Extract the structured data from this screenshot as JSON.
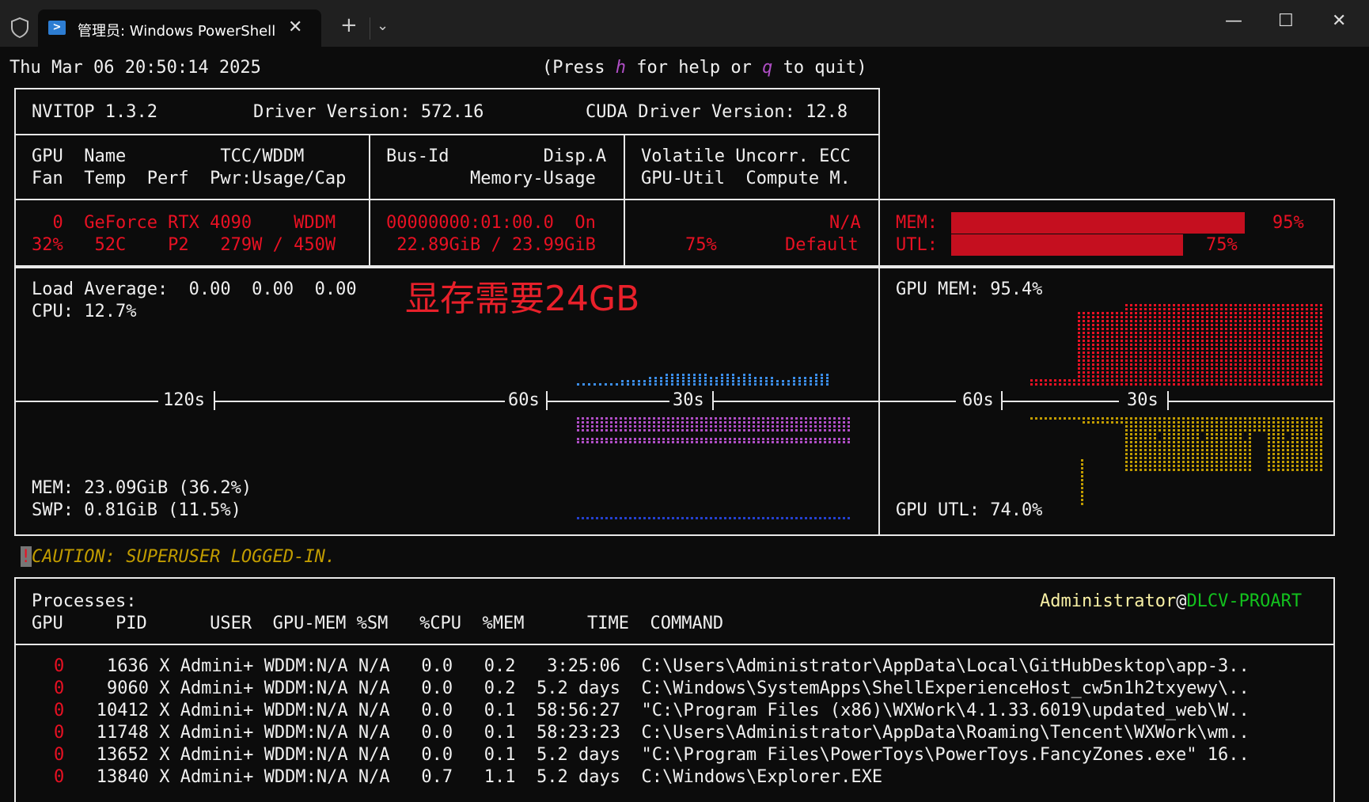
{
  "window": {
    "tab_title": "管理员: Windows PowerShell",
    "tab_close": "✕",
    "new_tab": "+",
    "dropdown": "⌄",
    "minimize": "—",
    "maximize": "☐",
    "close": "✕"
  },
  "header": {
    "datetime": "Thu Mar 06 20:50:14 2025",
    "help_pre": "(Press ",
    "help_h": "h",
    "help_mid": " for help or ",
    "help_q": "q",
    "help_post": " to quit)"
  },
  "top": {
    "version": "NVITOP 1.3.2",
    "driver": "Driver Version: 572.16",
    "cuda": "CUDA Driver Version: 12.8"
  },
  "columns": {
    "c1_l1": "GPU  Name         TCC/WDDM",
    "c1_l2": "Fan  Temp  Perf  Pwr:Usage/Cap",
    "c2_l1": "Bus-Id         Disp.A",
    "c2_l2": "        Memory-Usage",
    "c3_l1": "Volatile Uncorr. ECC",
    "c3_l2": "GPU-Util  Compute M."
  },
  "gpu": {
    "r1": "  0  GeForce RTX 4090    WDDM",
    "r2": "32%   52C    P2   279W / 450W",
    "bus": "00000000:01:00.0  On",
    "mem_usage": " 22.89GiB / 23.99GiB",
    "ecc": "N/A",
    "util": "75%",
    "compute": "Default",
    "mem_label": "MEM:",
    "mem_pct_text": "95%",
    "mem_fraction": 0.95,
    "utl_label": "UTL:",
    "utl_pct_text": "75%",
    "utl_fraction": 0.75
  },
  "host": {
    "load": "Load Average:  0.00  0.00  0.00",
    "cpu": "CPU: 12.7%",
    "mem": "MEM: 23.09GiB (36.2%)",
    "swp": "SWP: 0.81GiB (11.5%)",
    "annotation": "显存需要24GB",
    "tick_120": "120s",
    "tick_60": "60s",
    "tick_30": "30s"
  },
  "gpu_graph": {
    "mem": "GPU MEM: 95.4%",
    "utl": "GPU UTL: 74.0%",
    "tick_60": "60s",
    "tick_30": "30s"
  },
  "caution": {
    "mark": "!",
    "text": "CAUTION: SUPERUSER LOGGED-IN."
  },
  "processes": {
    "title": "Processes:",
    "user": "Administrator",
    "at": "@",
    "host": "DLCV-PROART",
    "header": "GPU     PID      USER  GPU-MEM %SM   %CPU  %MEM      TIME  COMMAND",
    "rows": [
      {
        "gpu": "0",
        "rest": "    1636 X Admini+ WDDM:N/A N/A   0.0   0.2   3:25:06  C:\\Users\\Administrator\\AppData\\Local\\GitHubDesktop\\app-3.."
      },
      {
        "gpu": "0",
        "rest": "    9060 X Admini+ WDDM:N/A N/A   0.0   0.2  5.2 days  C:\\Windows\\SystemApps\\ShellExperienceHost_cw5n1h2txyewy\\.."
      },
      {
        "gpu": "0",
        "rest": "   10412 X Admini+ WDDM:N/A N/A   0.0   0.1  58:56:27  \"C:\\Program Files (x86)\\WXWork\\4.1.33.6019\\updated_web\\W.."
      },
      {
        "gpu": "0",
        "rest": "   11748 X Admini+ WDDM:N/A N/A   0.0   0.1  58:23:23  C:\\Users\\Administrator\\AppData\\Roaming\\Tencent\\WXWork\\wm.."
      },
      {
        "gpu": "0",
        "rest": "   13652 X Admini+ WDDM:N/A N/A   0.0   0.1  5.2 days  \"C:\\Program Files\\PowerToys\\PowerToys.FancyZones.exe\" 16.."
      },
      {
        "gpu": "0",
        "rest": "   13840 X Admini+ WDDM:N/A N/A   0.7   1.1  5.2 days  C:\\Windows\\Explorer.EXE"
      }
    ]
  }
}
